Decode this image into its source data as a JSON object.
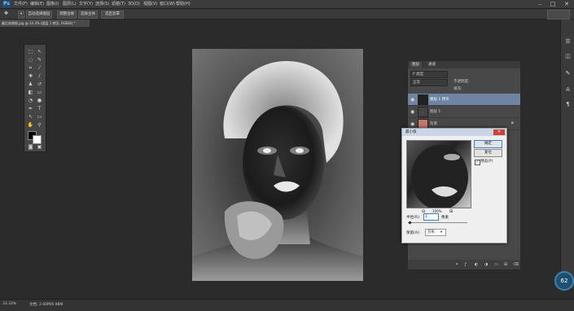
{
  "menubar": {
    "logo": "Ps",
    "items": [
      "文件(F)",
      "编辑(E)",
      "图像(I)",
      "图层(L)",
      "文字(Y)",
      "选择(S)",
      "滤镜(T)",
      "3D(D)",
      "视图(V)",
      "窗口(W)",
      "帮助(H)"
    ],
    "min": "–",
    "max": "□",
    "close": "✕"
  },
  "options": {
    "b1": "自动选择图层",
    "b2": "调整边缘",
    "b3": "选择主体",
    "b4": "选区遮罩"
  },
  "document": {
    "tab": "最后效果图.jpg @ 33.3% (图层 1 拷贝, RGB/8) *",
    "zoom": "33.33%",
    "doc_info": "文档: 2.00M/6.98M"
  },
  "layers": {
    "tab1": "图层",
    "tab2": "通道",
    "kind": "P 类型",
    "blend": "正常",
    "opacity_label": "不透明度:",
    "fill_label": "填充:",
    "rows": [
      {
        "name": "图层 1 拷贝",
        "selected": true
      },
      {
        "name": "图层 1",
        "selected": false
      },
      {
        "name": "背景",
        "selected": false
      }
    ]
  },
  "dialog": {
    "title": "最小值",
    "ok": "确定",
    "reset": "复位",
    "preview": "预览(P)",
    "zoom": "100%",
    "radius_label": "半径(R):",
    "radius_value": "1",
    "radius_unit": "像素",
    "preserve_label": "保留(A):",
    "preserve_value": "方形"
  },
  "badge": {
    "value": "62"
  },
  "colors": {
    "accent": "#6f84a3",
    "bg": "#2b2b2b",
    "panel": "#484848"
  }
}
